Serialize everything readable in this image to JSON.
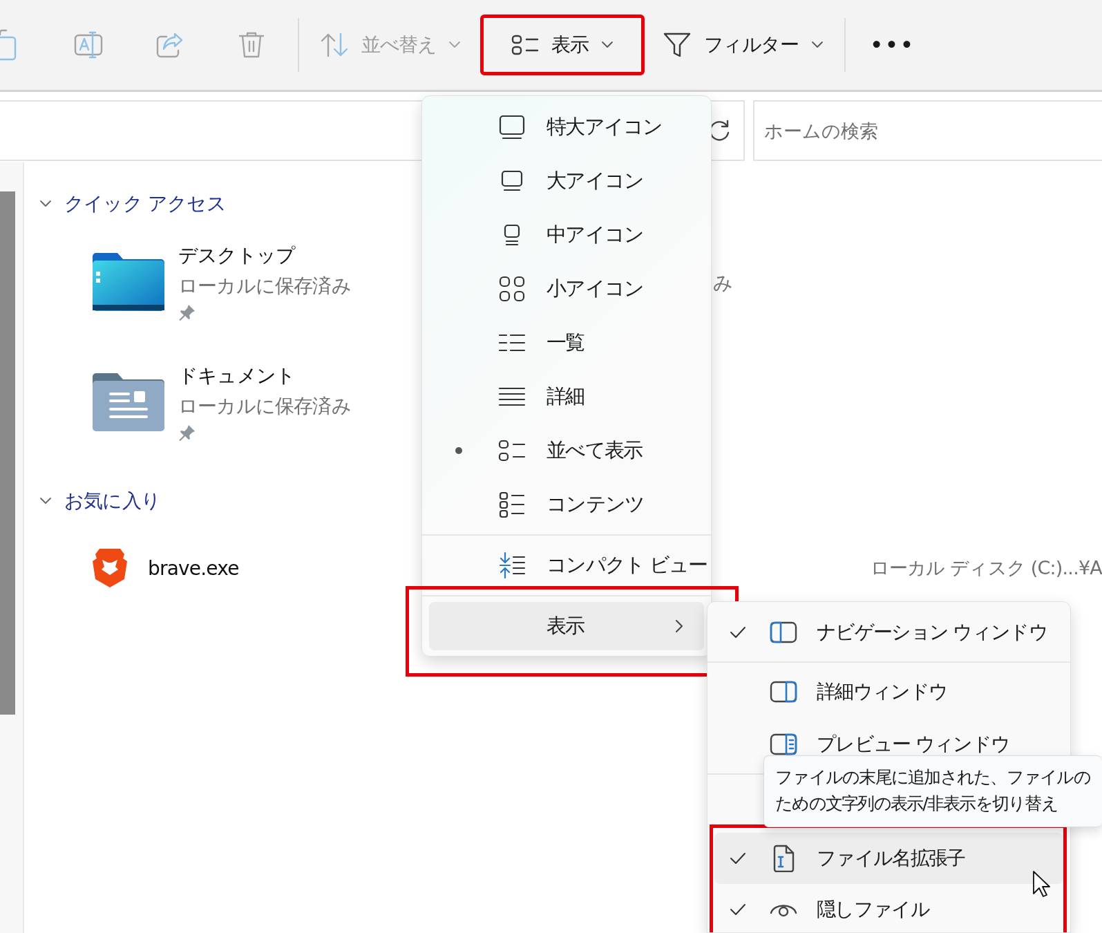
{
  "toolbar": {
    "buttons": [
      {
        "kind": "copy",
        "disabled": true
      },
      {
        "kind": "rename",
        "disabled": true
      },
      {
        "kind": "share",
        "disabled": true
      },
      {
        "kind": "delete",
        "disabled": true
      },
      {
        "kind": "separator"
      },
      {
        "kind": "sort",
        "label": "並べ替え",
        "disabled": true,
        "highlighted": false
      },
      {
        "kind": "view",
        "label": "表示",
        "disabled": false,
        "highlighted": true
      },
      {
        "kind": "filter",
        "label": "フィルター",
        "disabled": false,
        "highlighted": false
      },
      {
        "kind": "separator"
      },
      {
        "kind": "more",
        "label": "•••",
        "disabled": false
      }
    ]
  },
  "address_bar": {
    "search": {
      "placeholder": "ホームの検索"
    }
  },
  "content": {
    "groups": [
      {
        "title": "クイック アクセス",
        "expanded": true,
        "partial_text": "み",
        "items": [
          {
            "kind": "desktop-folder",
            "name": "デスクトップ",
            "status": "ローカルに保存済み",
            "pinned": true
          },
          {
            "kind": "documents-folder",
            "name": "ドキュメント",
            "status": "ローカルに保存済み",
            "pinned": true
          }
        ]
      },
      {
        "title": "お気に入り",
        "expanded": true,
        "items": [
          {
            "kind": "app",
            "name": "brave.exe",
            "location": "ローカル ディスク (C:)...¥A"
          }
        ]
      }
    ]
  },
  "view_menu": {
    "items": [
      {
        "kind": "xl-icons",
        "label": "特大アイコン",
        "selected": false
      },
      {
        "kind": "large-icons",
        "label": "大アイコン",
        "selected": false
      },
      {
        "kind": "medium-icons",
        "label": "中アイコン",
        "selected": false
      },
      {
        "kind": "small-icons",
        "label": "小アイコン",
        "selected": false
      },
      {
        "kind": "list",
        "label": "一覧",
        "selected": false
      },
      {
        "kind": "details",
        "label": "詳細",
        "selected": false
      },
      {
        "kind": "tiles",
        "label": "並べて表示",
        "selected": true
      },
      {
        "kind": "content",
        "label": "コンテンツ",
        "selected": false
      },
      {
        "kind": "separator"
      },
      {
        "kind": "compact",
        "label": "コンパクト ビュー",
        "checked": false
      },
      {
        "kind": "separator"
      },
      {
        "kind": "submenu",
        "label": "表示",
        "hovered": true,
        "highlighted": true
      }
    ]
  },
  "show_submenu": {
    "sections": [
      {
        "highlighted": false,
        "items": [
          {
            "kind": "nav-pane",
            "label": "ナビゲーション ウィンドウ",
            "checked": true,
            "hovered": false
          }
        ]
      },
      {
        "highlighted": false,
        "items": [
          {
            "kind": "details-pane",
            "label": "詳細ウィンドウ",
            "checked": false,
            "hovered": false
          },
          {
            "kind": "preview-pane",
            "label": "プレビュー ウィンドウ",
            "checked": false,
            "hovered": false
          }
        ]
      },
      {
        "highlighted": true,
        "items": [
          {
            "kind": "extensions",
            "label": "ファイル名拡張子",
            "checked": true,
            "hovered": true
          },
          {
            "kind": "hidden-items",
            "label": "隠しファイル",
            "checked": true,
            "hovered": false
          }
        ]
      }
    ]
  },
  "tooltip": {
    "lines": [
      "ファイルの末尾に追加された、ファイルの",
      "ための文字列の表示/非表示を切り替え"
    ]
  }
}
